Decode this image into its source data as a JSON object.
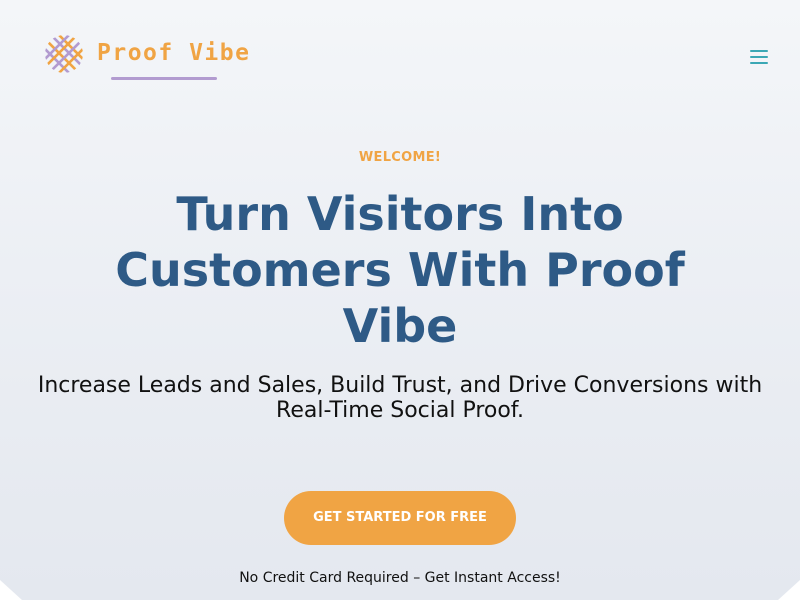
{
  "header": {
    "logo_text": "Proof Vibe",
    "logo_icon": "woven-circle-logo-icon",
    "menu_icon": "hamburger-menu-icon"
  },
  "hero": {
    "eyebrow": "WELCOME!",
    "headline": "Turn Visitors Into Customers With Proof Vibe",
    "subheadline": "Increase Leads and Sales, Build Trust, and Drive Conversions with Real-Time Social Proof.",
    "cta_label": "GET STARTED FOR FREE",
    "cta_note": "No Credit Card Required – Get Instant Access!"
  },
  "colors": {
    "accent_orange": "#f0a444",
    "headline_blue": "#2e5a86",
    "menu_teal": "#3ba7b5",
    "logo_purple": "#b29bd0"
  }
}
